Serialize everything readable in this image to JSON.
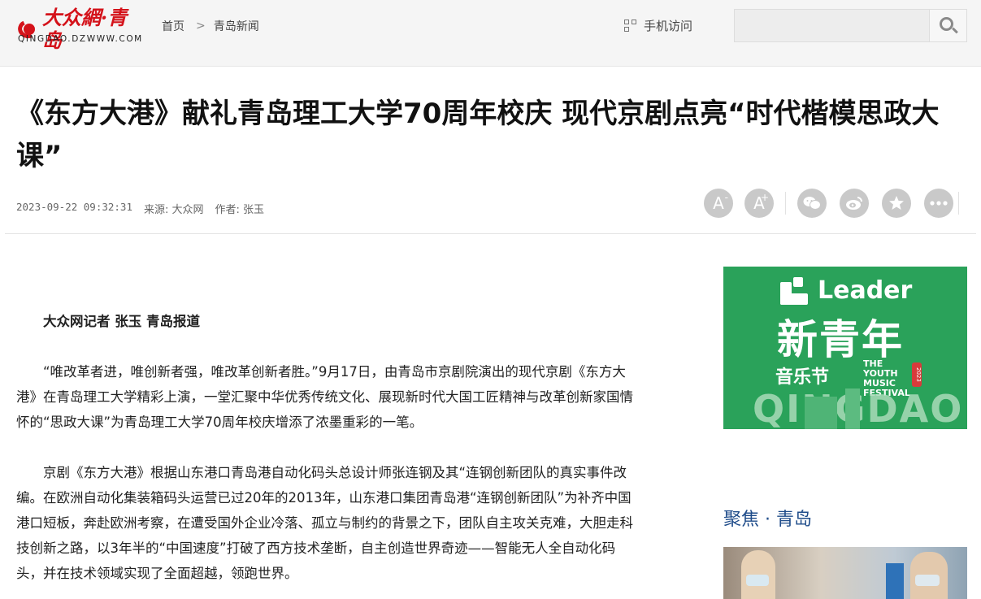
{
  "header": {
    "logo_text": "大众網·青岛",
    "logo_sub": "QINGDAO.DZWWW.COM",
    "breadcrumb": [
      "首页",
      "青岛新闻"
    ],
    "breadcrumb_sep": ">",
    "mobile_label": "手机访问",
    "search_placeholder": ""
  },
  "article": {
    "title": "《东方大港》献礼青岛理工大学70周年校庆 现代京剧点亮“时代楷模思政大课”",
    "date": "2023-09-22 09:32:31",
    "source": "来源: 大众网",
    "author": "作者: 张玉",
    "byline": "大众网记者 张玉 青岛报道",
    "paragraphs": [
      "“唯改革者进，唯创新者强，唯改革创新者胜。”9月17日，由青岛市京剧院演出的现代京剧《东方大港》在青岛理工大学精彩上演，一堂汇聚中华优秀传统文化、展现新时代大国工匠精神与改革创新家国情怀的“思政大课”为青岛理工大学70周年校庆增添了浓墨重彩的一笔。",
      "京剧《东方大港》根据山东港口青岛港自动化码头总设计师张连钢及其“连钢创新团队的真实事件改编。在欧洲自动化集装箱码头运营已过20年的2013年，山东港口集团青岛港“连钢创新团队”为补齐中国港口短板，奔赴欧洲考察，在遭受国外企业冷落、孤立与制约的背景之下，团队自主攻关克难，大胆走科技创新之路，以3年半的“中国速度”打破了西方技术垄断，自主创造世界奇迹——智能无人全自动化码头，并在技术领域实现了全面超越，领跑世界。"
    ]
  },
  "tools": {
    "font_small": "A",
    "font_small_sup": "-",
    "font_big": "A",
    "font_big_sup": "+",
    "icons": [
      "wechat-icon",
      "weibo-icon",
      "favorite-icon",
      "more-icon"
    ]
  },
  "sidebar": {
    "ad": {
      "brand": "Leader",
      "headline": "新青年",
      "festival": "音乐节",
      "festival_en": "THE YOUTH MUSIC FESTIVAL",
      "year": "2023",
      "city": "QINGDAO",
      "accent": "#2aa25a"
    },
    "focus_title": "聚焦 · 青岛"
  }
}
